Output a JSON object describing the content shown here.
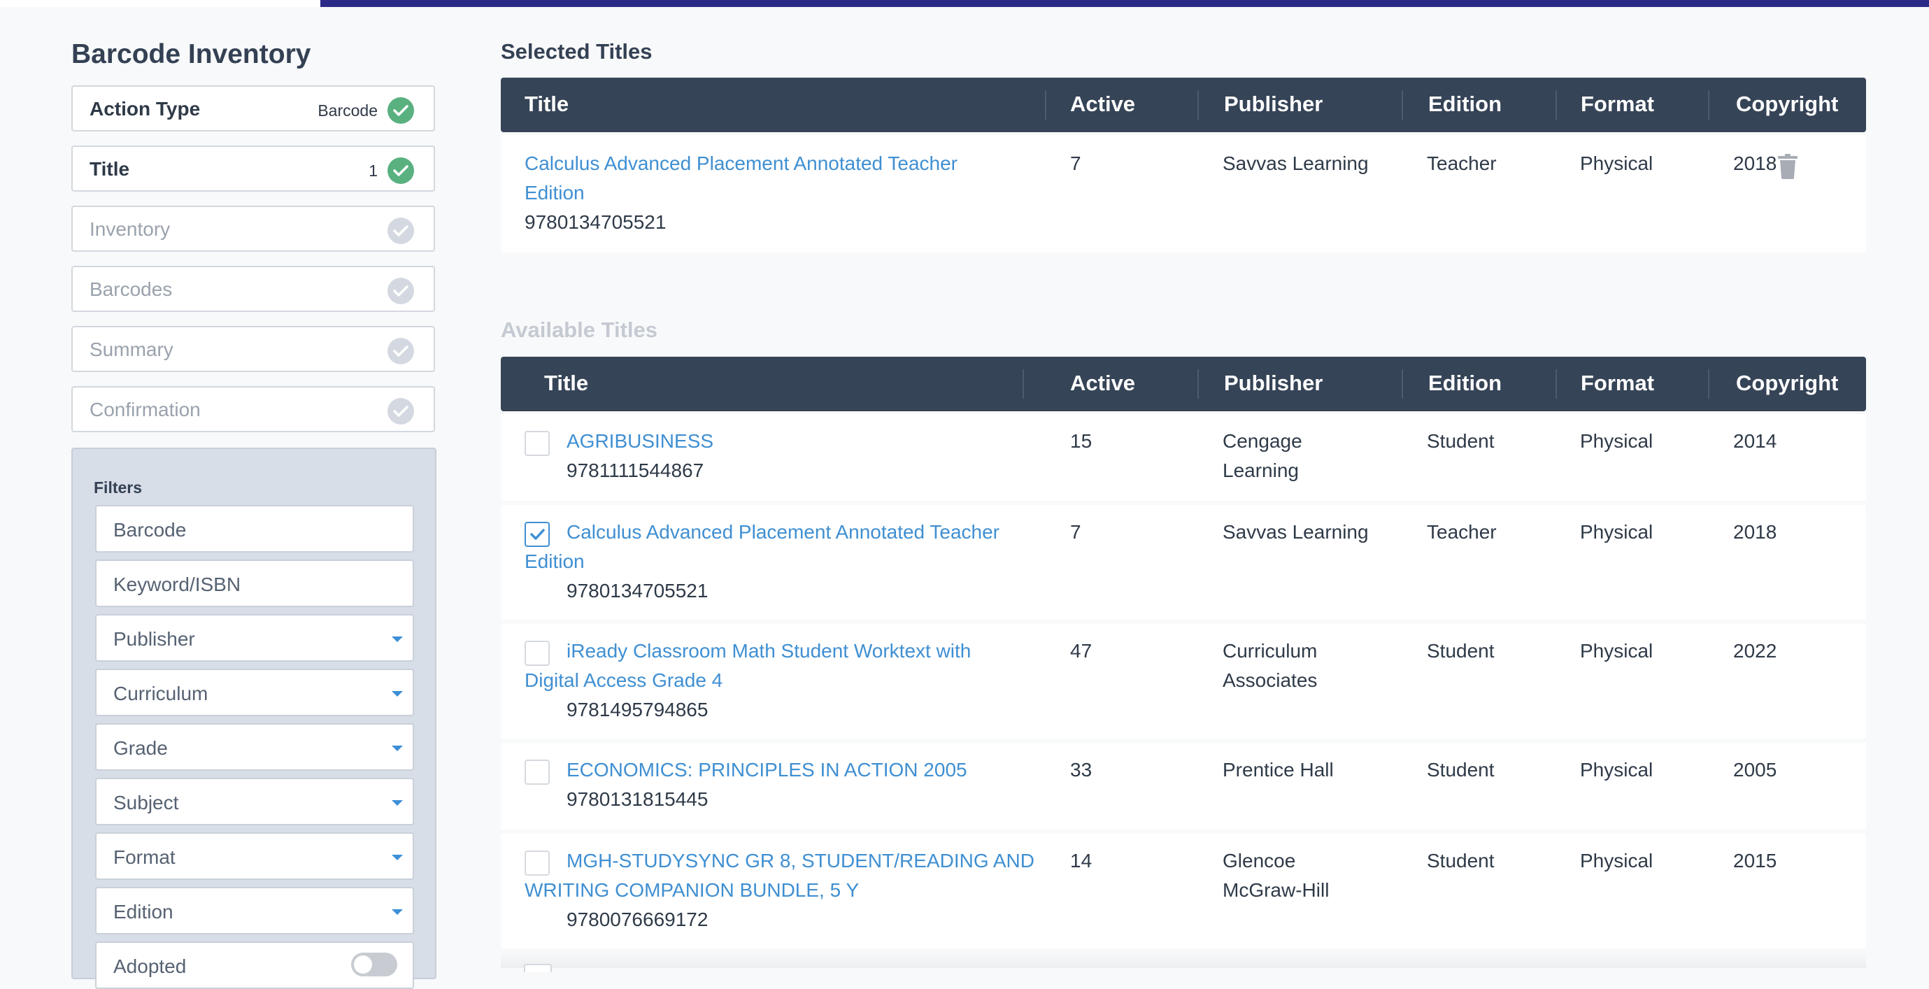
{
  "sidebar": {
    "title": "Barcode Inventory",
    "steps": [
      {
        "label": "Action Type",
        "value": "Barcode",
        "done": true
      },
      {
        "label": "Title",
        "value": "1",
        "done": true
      },
      {
        "label": "Inventory",
        "value": "",
        "done": false
      },
      {
        "label": "Barcodes",
        "value": "",
        "done": false
      },
      {
        "label": "Summary",
        "value": "",
        "done": false
      },
      {
        "label": "Confirmation",
        "value": "",
        "done": false
      }
    ],
    "filters": {
      "title": "Filters",
      "barcode_placeholder": "Barcode",
      "keyword_placeholder": "Keyword/ISBN",
      "publisher": "Publisher",
      "curriculum": "Curriculum",
      "grade": "Grade",
      "subject": "Subject",
      "format": "Format",
      "edition": "Edition",
      "adopted": "Adopted"
    }
  },
  "columns": [
    "Title",
    "Active",
    "Publisher",
    "Edition",
    "Format",
    "Copyright"
  ],
  "selected": {
    "heading": "Selected Titles",
    "rows": [
      {
        "title_line1": "Calculus Advanced Placement Annotated Teacher",
        "title_line2": "Edition",
        "isbn": "9780134705521",
        "active": "7",
        "publisher": "Savvas Learning",
        "edition": "Teacher",
        "format": "Physical",
        "copyright": "2018"
      }
    ]
  },
  "available": {
    "heading": "Available Titles",
    "rows": [
      {
        "title_line1": "AGRIBUSINESS",
        "title_line2": "",
        "isbn": "9781111544867",
        "active": "15",
        "publisher_line1": "Cengage",
        "publisher_line2": "Learning",
        "edition": "Student",
        "format": "Physical",
        "copyright": "2014",
        "checked": false
      },
      {
        "title_line1": "Calculus Advanced Placement Annotated Teacher",
        "title_line2": "Edition",
        "isbn": "9780134705521",
        "active": "7",
        "publisher_line1": "Savvas Learning",
        "publisher_line2": "",
        "edition": "Teacher",
        "format": "Physical",
        "copyright": "2018",
        "checked": true
      },
      {
        "title_line1": "iReady Classroom Math Student Worktext with",
        "title_line2": "Digital Access Grade 4",
        "isbn": "9781495794865",
        "active": "47",
        "publisher_line1": "Curriculum",
        "publisher_line2": "Associates",
        "edition": "Student",
        "format": "Physical",
        "copyright": "2022",
        "checked": false
      },
      {
        "title_line1": "ECONOMICS: PRINCIPLES IN ACTION 2005",
        "title_line2": "",
        "isbn": "9780131815445",
        "active": "33",
        "publisher_line1": "Prentice Hall",
        "publisher_line2": "",
        "edition": "Student",
        "format": "Physical",
        "copyright": "2005",
        "checked": false
      },
      {
        "title_line1": "MGH-STUDYSYNC GR 8, STUDENT/READING AND",
        "title_line2": "WRITING COMPANION BUNDLE, 5 Y",
        "isbn": "9780076669172",
        "active": "14",
        "publisher_line1": "Glencoe",
        "publisher_line2": "McGraw-Hill",
        "edition": "Student",
        "format": "Physical",
        "copyright": "2015",
        "checked": false
      }
    ]
  },
  "colors": {
    "accent_bar": "#2b2a86",
    "header_bg": "#364457",
    "link": "#3f8fd2",
    "check_done": "#5ab180",
    "check_pending": "#d4d9e1"
  }
}
